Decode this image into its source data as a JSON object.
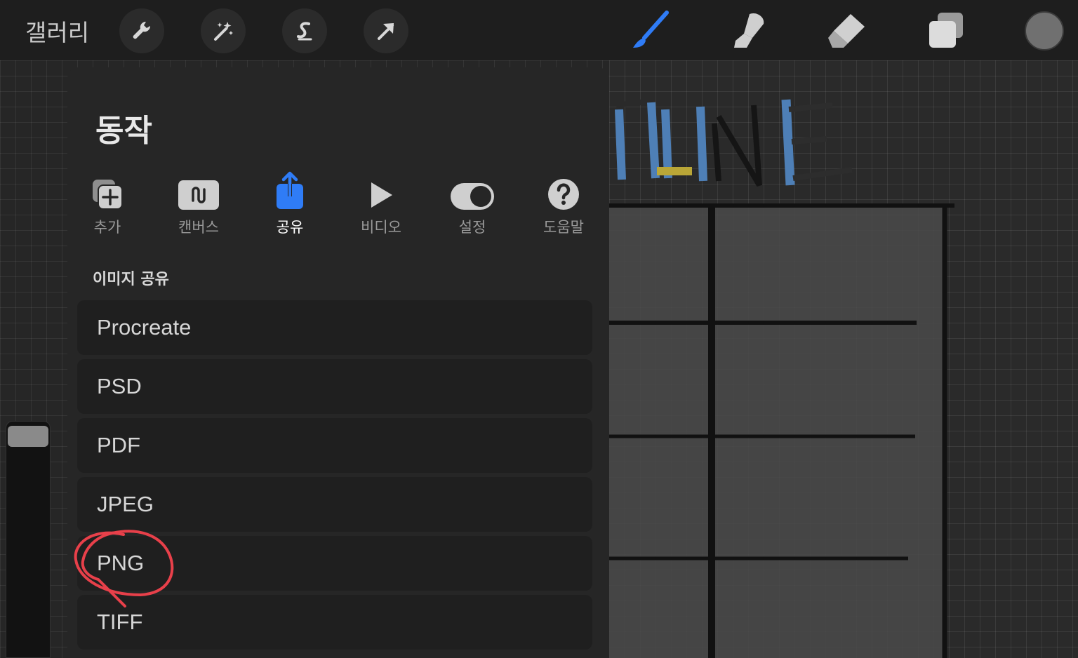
{
  "topbar": {
    "gallery_label": "갤러리",
    "left_tools": [
      "wrench-icon",
      "magic-wand-icon",
      "selection-icon",
      "transform-arrow-icon"
    ],
    "right_tools": [
      "brush-icon",
      "smudge-icon",
      "eraser-icon",
      "layers-icon"
    ],
    "active_color": "#707070",
    "accent": "#2f7cf6"
  },
  "panel": {
    "title": "동작",
    "tabs": [
      {
        "label": "추가",
        "icon": "add-icon"
      },
      {
        "label": "캔버스",
        "icon": "canvas-icon"
      },
      {
        "label": "공유",
        "icon": "share-icon",
        "active": true
      },
      {
        "label": "비디오",
        "icon": "play-icon"
      },
      {
        "label": "설정",
        "icon": "toggle-icon"
      },
      {
        "label": "도움말",
        "icon": "help-icon"
      }
    ],
    "section_label": "이미지 공유",
    "options": [
      "Procreate",
      "PSD",
      "PDF",
      "JPEG",
      "PNG",
      "TIFF"
    ],
    "highlighted_option": "PNG",
    "highlight_color": "#e8404a"
  }
}
